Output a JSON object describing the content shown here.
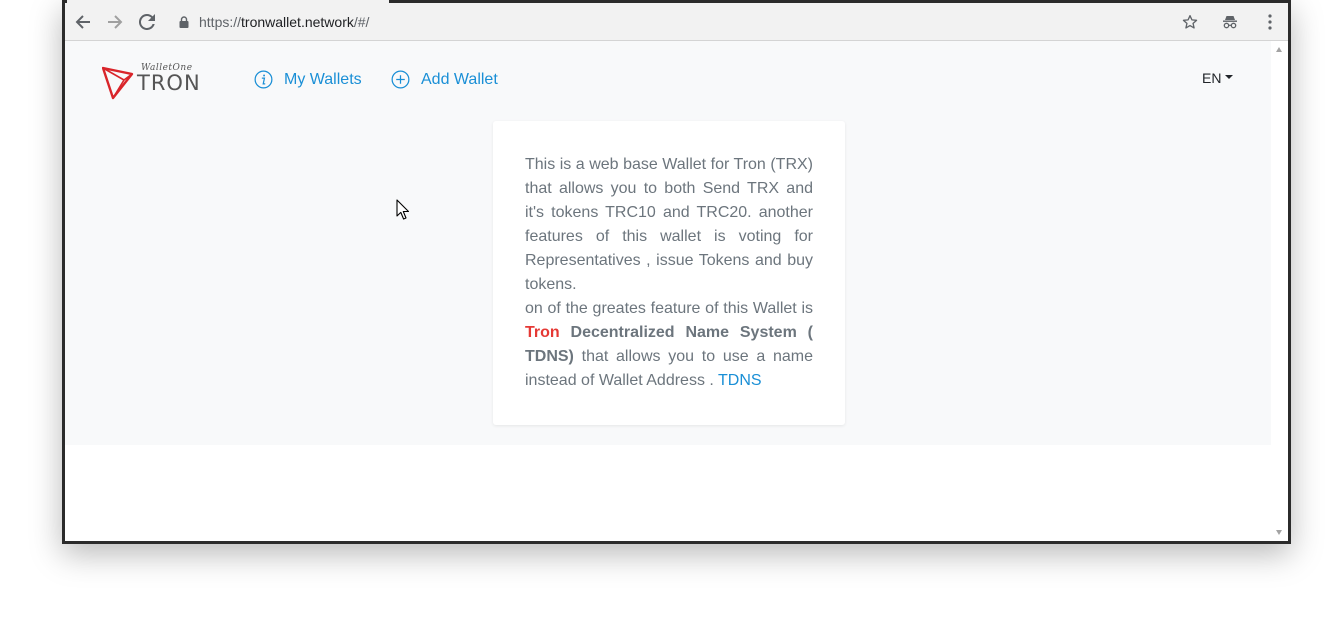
{
  "browser": {
    "url_scheme": "https://",
    "url_host": "tronwallet.network",
    "url_path": "/#/"
  },
  "brand": {
    "script": "WalletOne",
    "name": "TRON"
  },
  "nav": {
    "my_wallets": "My Wallets",
    "add_wallet": "Add Wallet",
    "language": "EN"
  },
  "card": {
    "paragraph1": "This is a web base Wallet for Tron (TRX) that allows you to both Send TRX and it's tokens TRC10 and TRC20. another features of this wallet is voting for Representatives , issue Tokens and buy tokens.",
    "p2_lead": "on of the greates feature of this Wallet is ",
    "p2_tron": "Tron",
    "p2_bold": " Decentralized Name System ( TDNS)",
    "p2_rest": " that allows you to use a name instead of Wallet Address . ",
    "p2_link": "TDNS"
  },
  "colors": {
    "link_blue": "#1a8fd6",
    "tron_red": "#e53935",
    "text_gray": "#6c757d",
    "page_bg": "#f8f9fa"
  },
  "icons": [
    "back-arrow-icon",
    "forward-arrow-icon",
    "reload-icon",
    "lock-icon",
    "star-icon",
    "incognito-icon",
    "menu-kebab-icon",
    "tron-logo-icon",
    "info-circle-icon",
    "plus-circle-icon",
    "mouse-cursor-icon"
  ]
}
